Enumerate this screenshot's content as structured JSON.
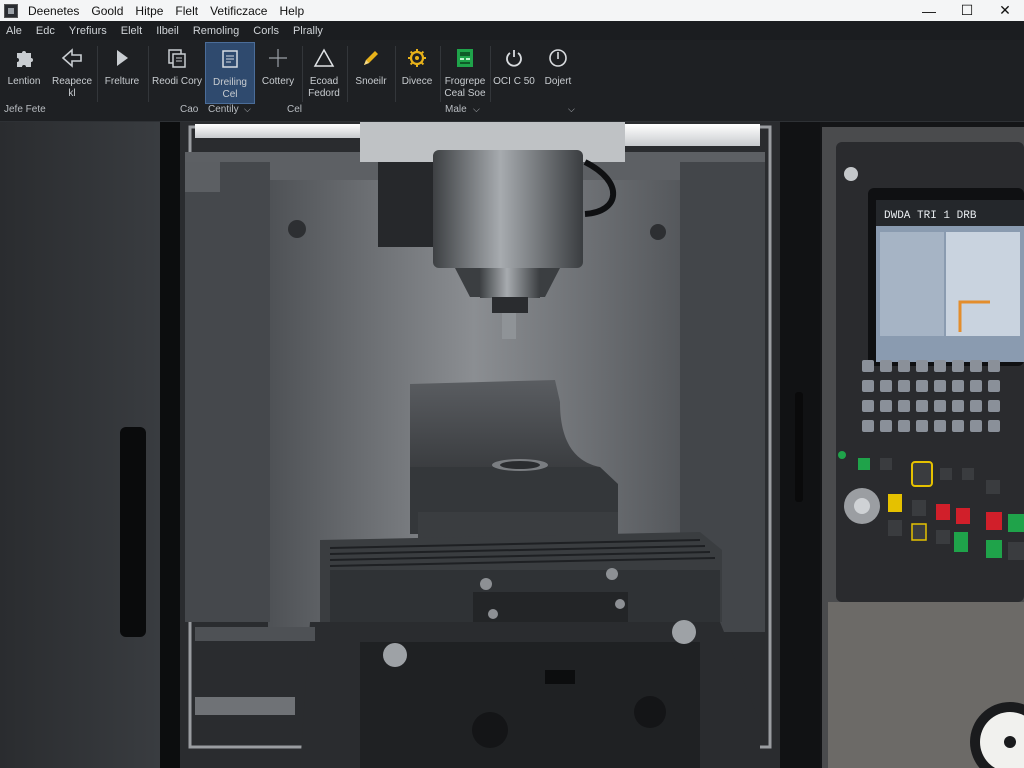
{
  "titlebar": {
    "menus": [
      "Deenetes",
      "Goold",
      "Hitpe",
      "Flelt",
      "Vetificzace",
      "Help"
    ],
    "minimize": "—",
    "maximize": "☐",
    "close": "✕"
  },
  "menubar": {
    "items": [
      "Ale",
      "Edc",
      "Yrefiurs",
      "Elelt",
      "Ilbeil",
      "Remoling",
      "Corls",
      "Plrally"
    ]
  },
  "ribbon": {
    "buttons": [
      {
        "label": "Lention",
        "icon": "puzzle-icon"
      },
      {
        "label": "Reapece\nkl",
        "icon": "arrow-shape-icon"
      },
      {
        "label": "Frelture",
        "icon": "arrow-right-icon"
      },
      {
        "label": "Reodi Cory",
        "icon": "copy-icon"
      },
      {
        "label": "Dreiling\nCel",
        "icon": "document-icon"
      },
      {
        "label": "Cottery",
        "icon": "crosshair-icon"
      },
      {
        "label": "Ecoad\nFedord",
        "icon": "triangle-icon"
      },
      {
        "label": "Snoeilr",
        "icon": "pencil-icon"
      },
      {
        "label": "Divece",
        "icon": "gear-icon"
      },
      {
        "label": "Frogrepe\nCeal Soe",
        "icon": "green-panel-icon"
      },
      {
        "label": "OCI C 50",
        "icon": "power-icon"
      },
      {
        "label": "Dojert",
        "icon": "power-alt-icon"
      }
    ],
    "groups": {
      "left": "Jefe Fete",
      "cao": "Cao",
      "centily": "Centily",
      "cel": "Cel",
      "male": "Male"
    },
    "chevron": "⌵"
  },
  "control_panel": {
    "screen_title": "DWDA TRI 1 DRB"
  },
  "colors": {
    "accent_active": "#2f4a6e",
    "green": "#1fa34a",
    "yellow": "#e5c100",
    "red": "#d11f2a"
  }
}
